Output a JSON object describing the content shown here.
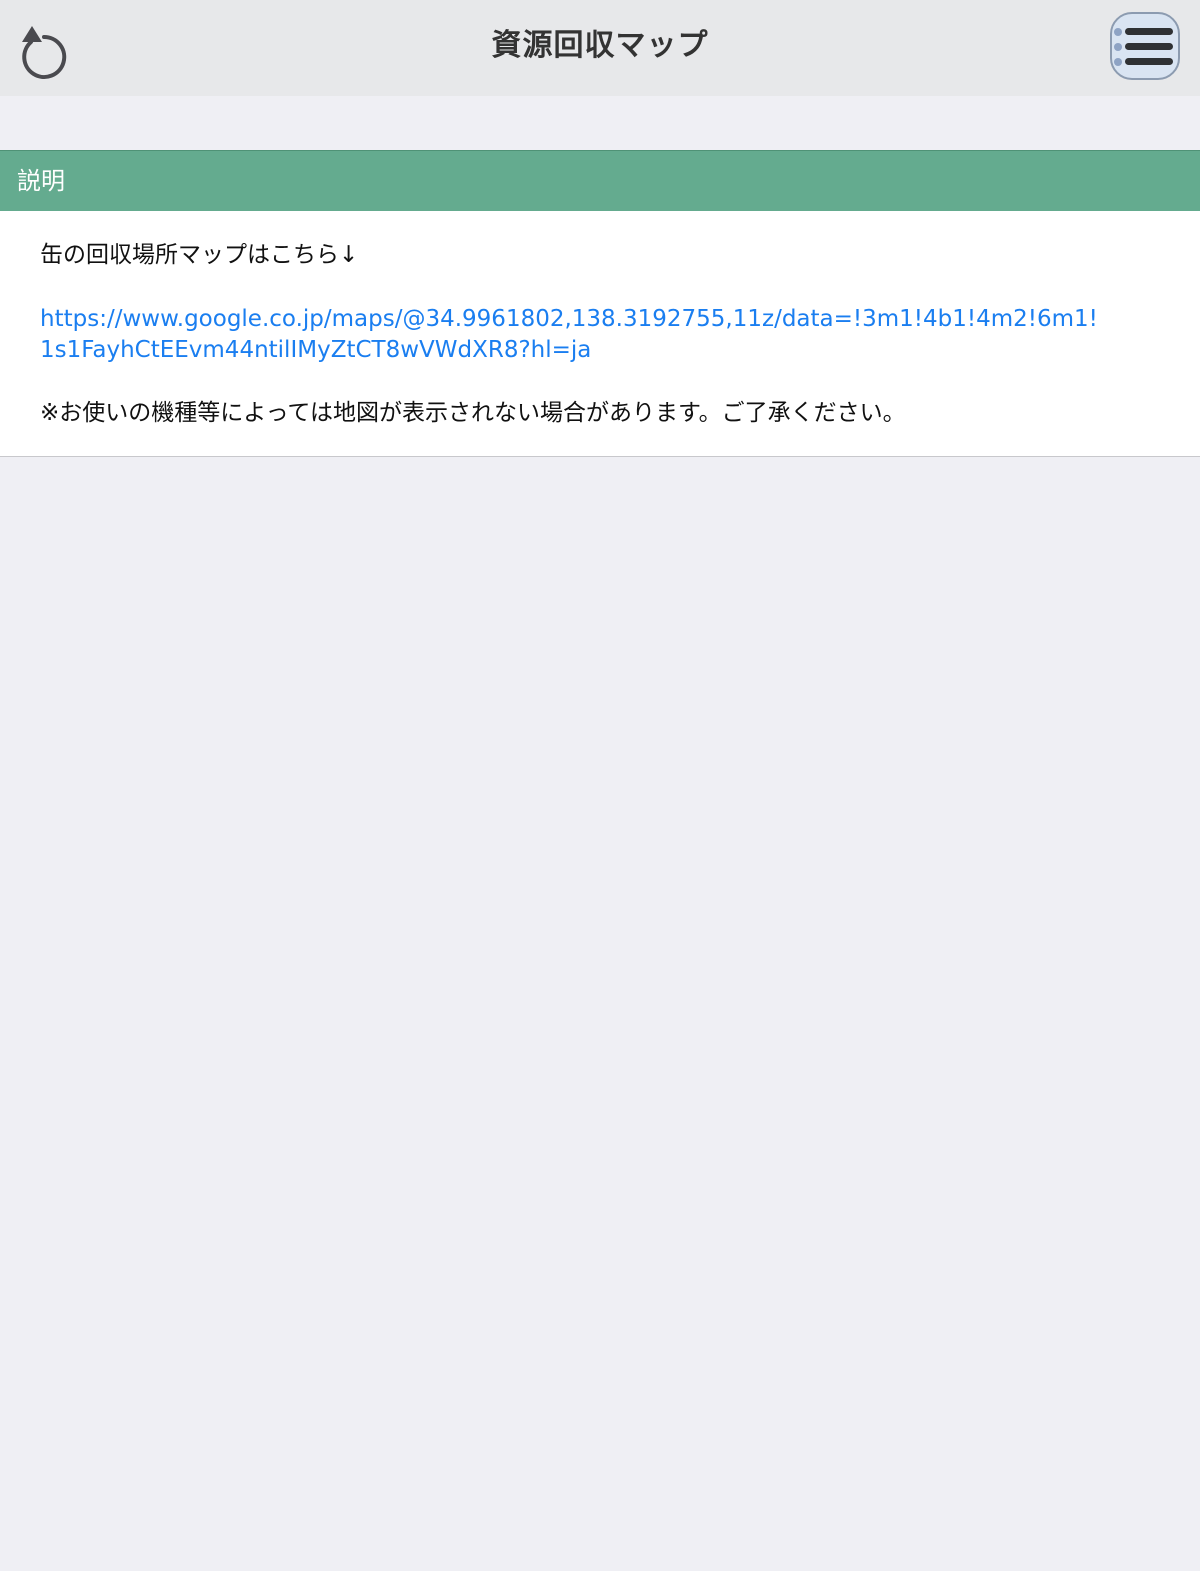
{
  "navbar": {
    "title": "資源回収マップ",
    "back_icon": "undo-icon",
    "menu_icon": "hamburger-menu-icon"
  },
  "section": {
    "title": "説明"
  },
  "content": {
    "intro": "缶の回収場所マップはこちら↓",
    "link_line1": "https://www.google.co.jp/maps/@34.9961802,138.3192755,11z/data=!3m1!4b1!4m2!6m1!",
    "link_line2": "1s1FayhCtEEvm44ntilIMyZtCT8wVWdXR8?hl=ja",
    "note": "※お使いの機種等によっては地図が表示されない場合があります。ご了承ください。"
  },
  "colors": {
    "section_header": "#64ab8f",
    "link": "#1a7ef0",
    "navbar_bg": "#e7e8ea",
    "page_bg": "#efeff4"
  }
}
